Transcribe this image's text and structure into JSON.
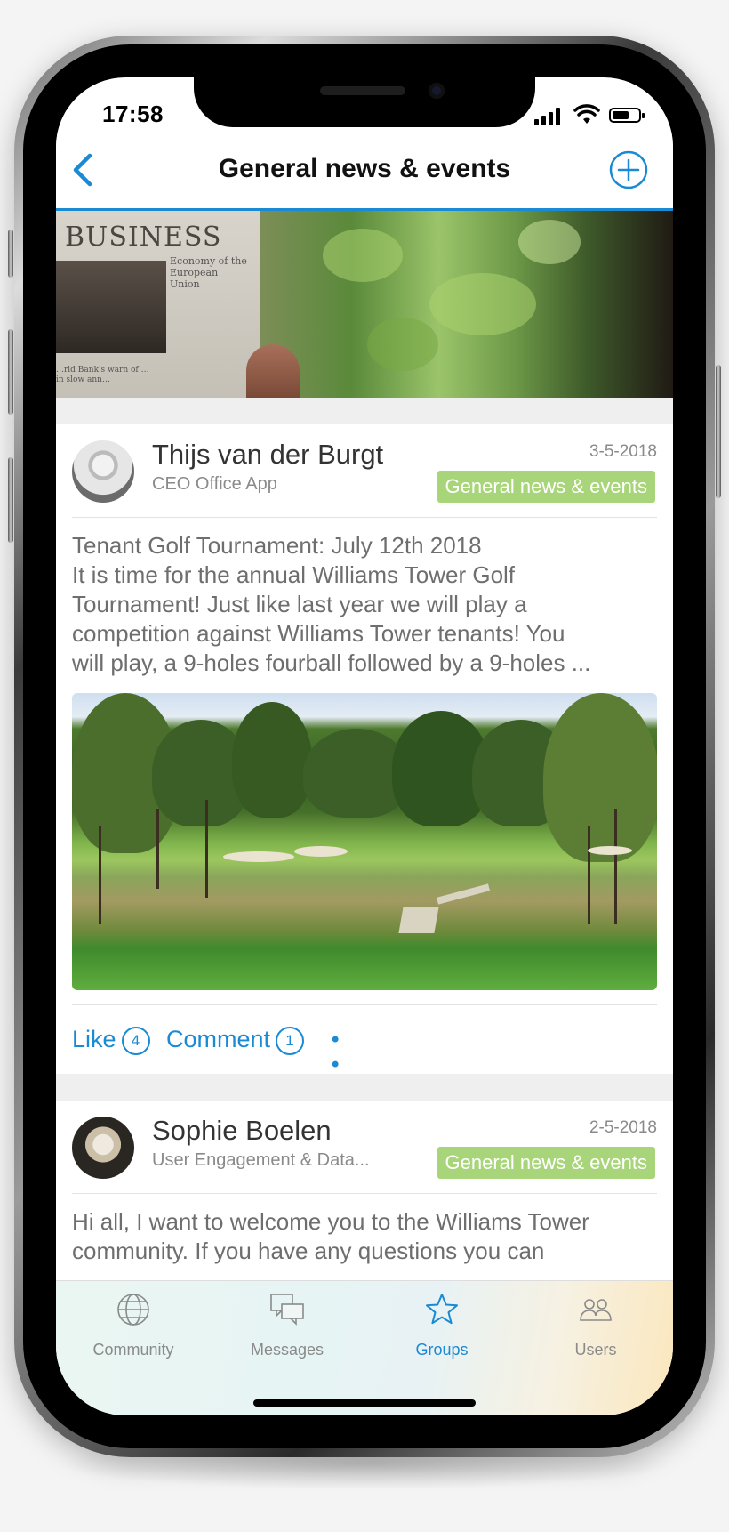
{
  "status_bar": {
    "time": "17:58"
  },
  "header": {
    "title": "General news & events"
  },
  "banner": {
    "headline": "BUSINESS",
    "subheading": "Economy of the European Union",
    "caption": "…rld Bank's warn of … in slow ann…"
  },
  "posts": [
    {
      "author": "Thijs van der Burgt",
      "role": "CEO Office App",
      "date": "3-5-2018",
      "group_badge": "General news & events",
      "text_lines": [
        "Tenant Golf Tournament: July 12th 2018",
        "It is time for the annual Williams Tower Golf",
        "Tournament! Just like last year we will play a",
        "competition against Williams Tower tenants! You",
        "will play, a 9-holes fourball followed by a 9-holes ..."
      ],
      "like_label": "Like",
      "like_count": "4",
      "comment_label": "Comment",
      "comment_count": "1",
      "more": "• • •"
    },
    {
      "author": "Sophie Boelen",
      "role": "User Engagement & Data...",
      "date": "2-5-2018",
      "group_badge": "General news & events",
      "text_lines": [
        "Hi all, I want to welcome you to the Williams Tower",
        "community. If you have any questions you can"
      ]
    }
  ],
  "tabs": [
    {
      "label": "Community",
      "icon": "globe-icon"
    },
    {
      "label": "Messages",
      "icon": "chat-bubbles-icon"
    },
    {
      "label": "Groups",
      "icon": "star-icon",
      "active": true
    },
    {
      "label": "Users",
      "icon": "users-icon"
    }
  ],
  "colors": {
    "accent": "#1a8ad4",
    "badge": "#a8d57a"
  }
}
